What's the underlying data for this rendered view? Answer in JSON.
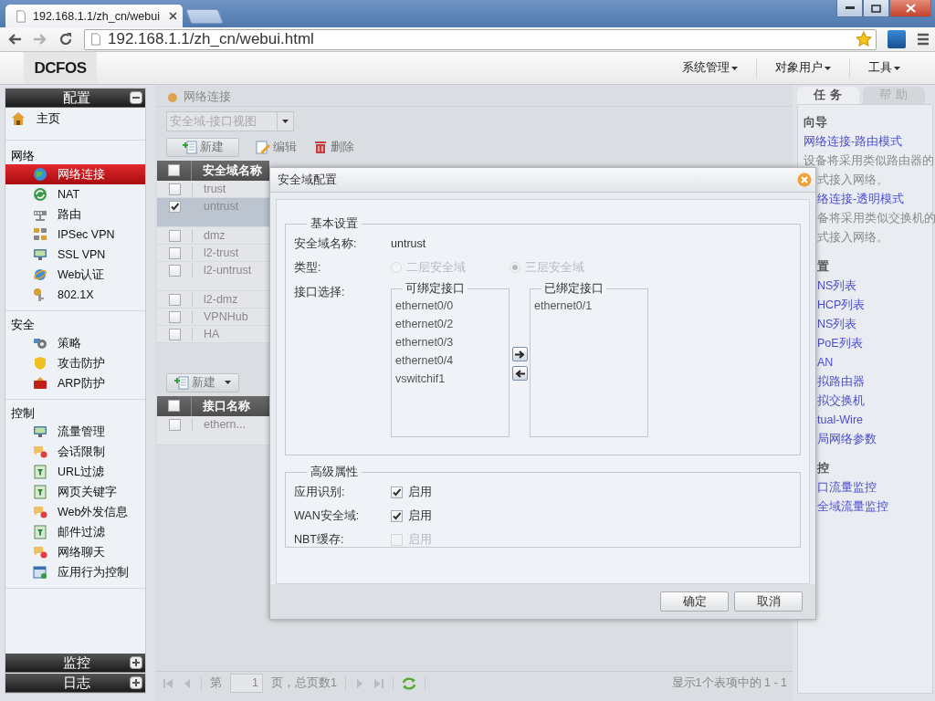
{
  "browser": {
    "tab_title": "192.168.1.1/zh_cn/webui",
    "address": "192.168.1.1/zh_cn/webui.html"
  },
  "app_bar": {
    "logo": "DCFOS",
    "menus": [
      {
        "label": "系统管理"
      },
      {
        "label": "对象用户"
      },
      {
        "label": "工具"
      }
    ]
  },
  "sidebar": {
    "panels": [
      {
        "title": "配置",
        "expanded": true
      },
      {
        "title": "监控",
        "expanded": false
      },
      {
        "title": "日志",
        "expanded": false
      }
    ],
    "home": {
      "label": "主页",
      "selected": false
    },
    "groups": [
      {
        "title": "网络",
        "items": [
          {
            "label": "网络连接",
            "selected": true
          },
          {
            "label": "NAT",
            "selected": false
          },
          {
            "label": "路由",
            "selected": false
          },
          {
            "label": "IPSec VPN",
            "selected": false
          },
          {
            "label": "SSL VPN",
            "selected": false
          },
          {
            "label": "Web认证",
            "selected": false
          },
          {
            "label": "802.1X",
            "selected": false
          }
        ]
      },
      {
        "title": "安全",
        "items": [
          {
            "label": "策略",
            "selected": false
          },
          {
            "label": "攻击防护",
            "selected": false
          },
          {
            "label": "ARP防护",
            "selected": false
          }
        ]
      },
      {
        "title": "控制",
        "items": [
          {
            "label": "流量管理",
            "selected": false
          },
          {
            "label": "会话限制",
            "selected": false
          },
          {
            "label": "URL过滤",
            "selected": false
          },
          {
            "label": "网页关键字",
            "selected": false
          },
          {
            "label": "Web外发信息",
            "selected": false
          },
          {
            "label": "邮件过滤",
            "selected": false
          },
          {
            "label": "网络聊天",
            "selected": false
          },
          {
            "label": "应用行为控制",
            "selected": false
          }
        ]
      }
    ]
  },
  "main": {
    "breadcrumb": "网络连接",
    "view_select": "安全域-接口视图",
    "toolbar": [
      "新建",
      "编辑",
      "删除"
    ],
    "zone_table": {
      "select_all_checked": false,
      "columns": [
        "安全域名称"
      ],
      "rows": [
        {
          "name": "trust",
          "kind": "single",
          "checked": false,
          "selected": false
        },
        {
          "name": "untrust",
          "kind": "double",
          "checked": true,
          "selected": true
        },
        {
          "name": "dmz",
          "kind": "single",
          "checked": false,
          "selected": false
        },
        {
          "name": "l2-trust",
          "kind": "single",
          "checked": false,
          "selected": false
        },
        {
          "name": "l2-untrust",
          "kind": "double",
          "checked": false,
          "selected": false
        },
        {
          "name": "l2-dmz",
          "kind": "single",
          "checked": false,
          "selected": false
        },
        {
          "name": "VPNHub",
          "kind": "single",
          "checked": false,
          "selected": false
        },
        {
          "name": "HA",
          "kind": "single",
          "checked": false,
          "selected": false
        }
      ]
    },
    "interface_toolbar": [
      "新建"
    ],
    "interface_table": {
      "select_all_checked": false,
      "columns": [
        "接口名称"
      ],
      "rows": [
        {
          "name": "ethern...",
          "kind": "double",
          "checked": false,
          "selected": false
        }
      ]
    },
    "pager": {
      "page_prefix": "第",
      "page": "1",
      "page_suffix": "页，总页数1",
      "summary": "显示1个表项中的 1 - 1"
    }
  },
  "task_panel": {
    "tabs": [
      {
        "label": "任 务",
        "selected": true
      },
      {
        "label": "帮 助",
        "selected": false
      }
    ],
    "lines": [
      {
        "kind": "heading",
        "text": "向导"
      },
      {
        "kind": "link",
        "text": "网络连接-路由模式"
      },
      {
        "kind": "desc",
        "text": "设备将采用类似路由器的"
      },
      {
        "kind": "desc",
        "text": "式接入网络。"
      },
      {
        "kind": "link",
        "text": "络连接-透明模式"
      },
      {
        "kind": "desc",
        "text": "备将采用类似交换机的"
      },
      {
        "kind": "desc",
        "text": "式接入网络。"
      },
      {
        "kind": "heading",
        "text": "置"
      },
      {
        "kind": "link",
        "text": "NS列表"
      },
      {
        "kind": "link",
        "text": "HCP列表"
      },
      {
        "kind": "link",
        "text": "NS列表"
      },
      {
        "kind": "link",
        "text": "PoE列表"
      },
      {
        "kind": "link",
        "text": "AN"
      },
      {
        "kind": "link",
        "text": "拟路由器"
      },
      {
        "kind": "link",
        "text": "拟交换机"
      },
      {
        "kind": "link",
        "text": "tual-Wire"
      },
      {
        "kind": "link",
        "text": "局网络参数"
      },
      {
        "kind": "heading",
        "text": "控"
      },
      {
        "kind": "link",
        "text": "口流量监控"
      },
      {
        "kind": "link",
        "text": "全域流量监控"
      }
    ]
  },
  "dialog": {
    "title": "安全域配置",
    "basic": {
      "legend": "基本设置",
      "name_label": "安全域名称:",
      "name_value": "untrust",
      "type_label": "类型:",
      "types": [
        {
          "label": "二层安全域",
          "selected": false,
          "disabled": true
        },
        {
          "label": "三层安全域",
          "selected": true,
          "disabled": true
        }
      ],
      "interface_label": "接口选择:",
      "available": {
        "title": "可绑定接口",
        "items": [
          "ethernet0/0",
          "ethernet0/2",
          "ethernet0/3",
          "ethernet0/4",
          "vswitchif1"
        ]
      },
      "bound": {
        "title": "已绑定接口",
        "items": [
          "ethernet0/1"
        ]
      }
    },
    "advanced": {
      "legend": "高级属性",
      "options": [
        {
          "label": "应用识别:",
          "text": "启用",
          "checked": true,
          "disabled": false
        },
        {
          "label": "WAN安全域:",
          "text": "启用",
          "checked": true,
          "disabled": false
        },
        {
          "label": "NBT缓存:",
          "text": "启用",
          "checked": false,
          "disabled": true
        }
      ]
    },
    "buttons": [
      "确定",
      "取消"
    ]
  }
}
